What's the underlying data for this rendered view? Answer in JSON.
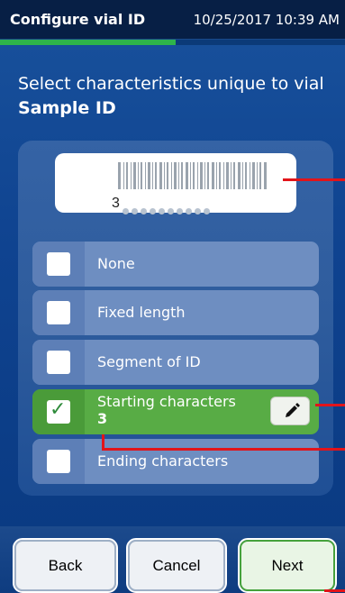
{
  "header": {
    "title": "Configure vial ID",
    "datetime": "10/25/2017 10:39 AM"
  },
  "progress": {
    "fraction": 0.51
  },
  "instruction": {
    "prefix": "Select characteristics unique to vial ",
    "emphasis": "Sample ID"
  },
  "barcode": {
    "starting_digit": "3",
    "remaining_placeholder_count": 10
  },
  "options": [
    {
      "label": "None",
      "checked": false
    },
    {
      "label": "Fixed length",
      "checked": false
    },
    {
      "label": "Segment of ID",
      "checked": false
    },
    {
      "label": "Starting characters",
      "checked": true,
      "value": "3"
    },
    {
      "label": "Ending characters",
      "checked": false
    }
  ],
  "buttons": {
    "back": "Back",
    "cancel": "Cancel",
    "next": "Next"
  },
  "colors": {
    "accent_green": "#58ac45",
    "header_bg": "#071f45",
    "callout_red": "#e2141a"
  },
  "icons": {
    "checkmark": "checkmark-icon",
    "edit": "pencil-icon"
  }
}
